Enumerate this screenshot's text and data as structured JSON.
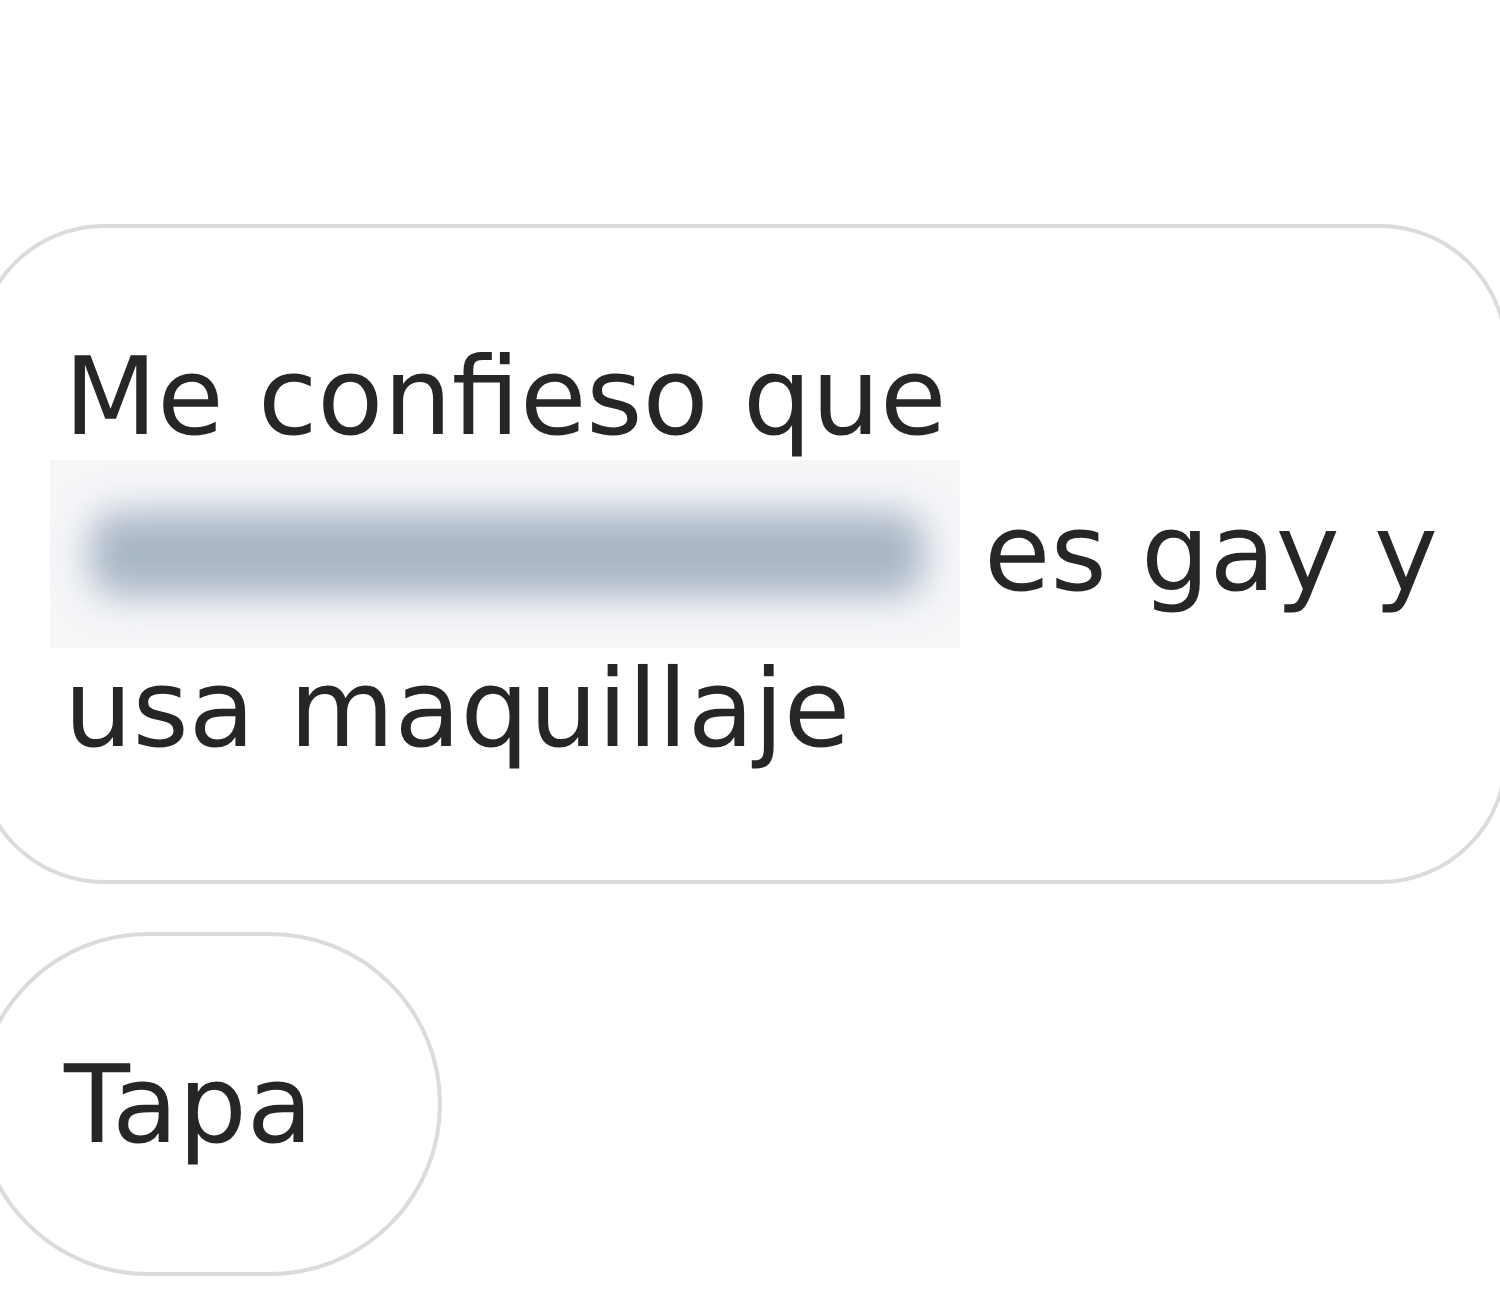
{
  "messages": [
    {
      "kind": "received",
      "parts": [
        {
          "kind": "text",
          "text": "Me confieso que"
        },
        {
          "kind": "redacted"
        },
        {
          "kind": "text",
          "text": "es gay y"
        },
        {
          "kind": "text",
          "text": "usa maquillaje"
        }
      ]
    },
    {
      "kind": "received",
      "parts": [
        {
          "kind": "text",
          "text": "Tapa"
        }
      ]
    }
  ]
}
